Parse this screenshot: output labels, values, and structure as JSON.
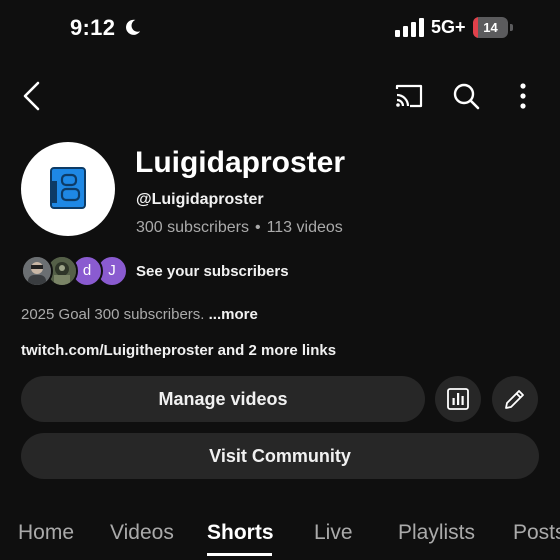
{
  "status_bar": {
    "time": "9:12",
    "network": "5G+",
    "battery_level": "14",
    "battery_fraction": 0.14,
    "battery_color": "#e0404a",
    "icons": [
      "moon-icon",
      "signal-icon",
      "battery-icon"
    ]
  },
  "top_bar": {
    "icons": [
      "back-icon",
      "cast-icon",
      "search-icon",
      "more-vert-icon"
    ]
  },
  "channel": {
    "name": "Luigidaproster",
    "handle": "@Luigidaproster",
    "subscribers": "300 subscribers",
    "dot": "•",
    "videos": "113 videos",
    "avatar_color": "#1e88e5"
  },
  "subscribers_row": {
    "avatars": [
      "photo",
      "photo",
      "d",
      "J"
    ],
    "avatar_letter_color": "#8a5bd0",
    "label": "See your subscribers"
  },
  "description": {
    "text": "2025 Goal 300 subscribers.",
    "more": "...more"
  },
  "links": {
    "text": "twitch.com/Luigitheproster and 2 more links"
  },
  "actions": {
    "manage_videos": "Manage videos",
    "visit_community": "Visit Community",
    "icons": [
      "analytics-icon",
      "edit-pencil-icon"
    ]
  },
  "tabs": [
    {
      "label": "Home",
      "active": false
    },
    {
      "label": "Videos",
      "active": false
    },
    {
      "label": "Shorts",
      "active": true
    },
    {
      "label": "Live",
      "active": false
    },
    {
      "label": "Playlists",
      "active": false
    },
    {
      "label": "Posts",
      "active": false
    }
  ]
}
